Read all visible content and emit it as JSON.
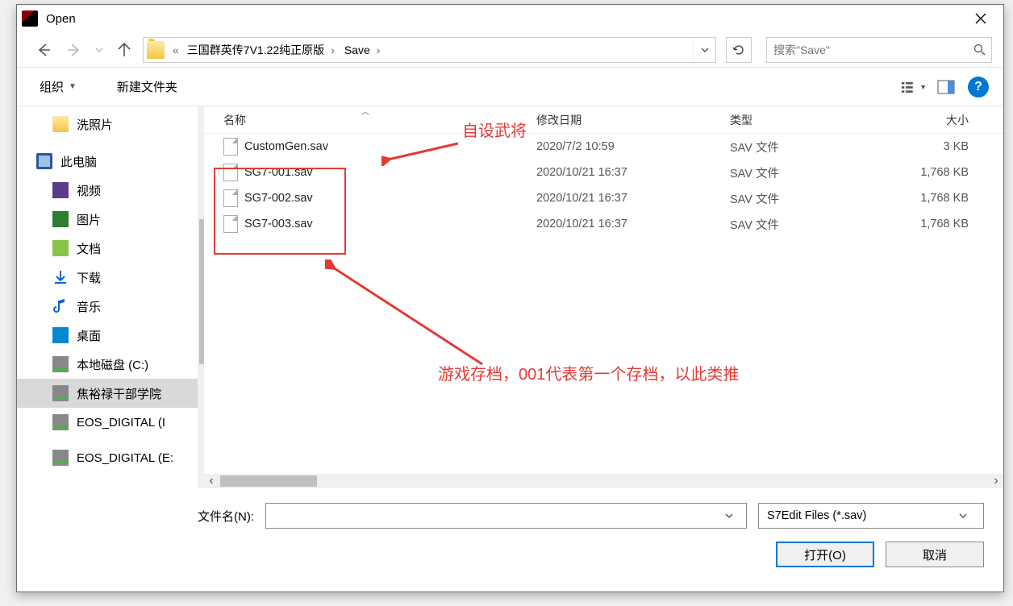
{
  "window": {
    "title": "Open"
  },
  "nav": {
    "path_prefix": "«",
    "crumbs": [
      "三国群英传7V1.22纯正原版",
      "Save"
    ],
    "search_placeholder": "搜索\"Save\""
  },
  "toolbar": {
    "organize": "组织",
    "new_folder": "新建文件夹"
  },
  "tree": [
    {
      "label": "洗照片",
      "icon": "folder"
    },
    {
      "label": "此电脑",
      "icon": "pc",
      "top": true
    },
    {
      "label": "视频",
      "icon": "vid"
    },
    {
      "label": "图片",
      "icon": "img"
    },
    {
      "label": "文档",
      "icon": "doc"
    },
    {
      "label": "下载",
      "icon": "dl"
    },
    {
      "label": "音乐",
      "icon": "music"
    },
    {
      "label": "桌面",
      "icon": "desk"
    },
    {
      "label": "本地磁盘 (C:)",
      "icon": "drive"
    },
    {
      "label": "焦裕禄干部学院",
      "icon": "drive",
      "sel": true
    },
    {
      "label": "EOS_DIGITAL (I",
      "icon": "drive"
    },
    {
      "label": "EOS_DIGITAL (E:",
      "icon": "drive",
      "top2": true
    }
  ],
  "columns": {
    "name": "名称",
    "date": "修改日期",
    "type": "类型",
    "size": "大小"
  },
  "files": [
    {
      "name": "CustomGen.sav",
      "date": "2020/7/2 10:59",
      "type": "SAV 文件",
      "size": "3 KB"
    },
    {
      "name": "SG7-001.sav",
      "date": "2020/10/21 16:37",
      "type": "SAV 文件",
      "size": "1,768 KB"
    },
    {
      "name": "SG7-002.sav",
      "date": "2020/10/21 16:37",
      "type": "SAV 文件",
      "size": "1,768 KB"
    },
    {
      "name": "SG7-003.sav",
      "date": "2020/10/21 16:37",
      "type": "SAV 文件",
      "size": "1,768 KB"
    }
  ],
  "annotations": {
    "a1": "自设武将",
    "a2": "游戏存档，001代表第一个存档，以此类推"
  },
  "bottom": {
    "filename_label": "文件名(N):",
    "filetype": "S7Edit Files (*.sav)",
    "open": "打开(O)",
    "cancel": "取消"
  }
}
